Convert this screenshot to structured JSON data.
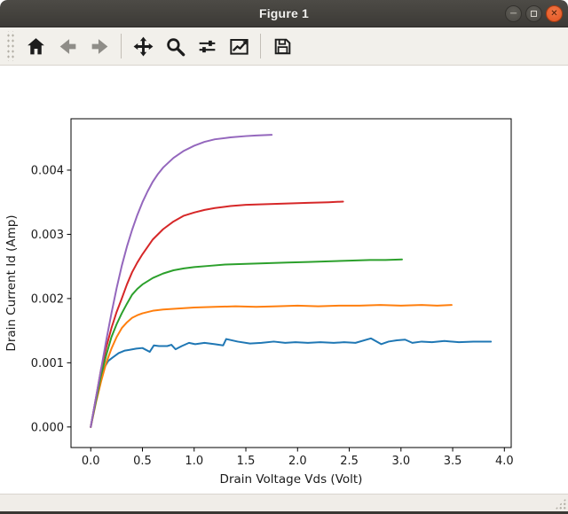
{
  "window": {
    "title": "Figure 1",
    "titlebar_color": "#403e3a",
    "controls": {
      "minimize": {
        "icon": "minimize-icon"
      },
      "maximize": {
        "icon": "maximize-icon"
      },
      "close": {
        "icon": "close-icon",
        "color": "#e35420"
      }
    }
  },
  "toolbar": {
    "buttons": [
      {
        "id": "home",
        "icon": "home-icon",
        "enabled": true
      },
      {
        "id": "back",
        "icon": "back-arrow-icon",
        "enabled": false
      },
      {
        "id": "forward",
        "icon": "forward-arrow-icon",
        "enabled": false
      },
      {
        "id": "pan",
        "icon": "pan-arrows-icon",
        "enabled": true
      },
      {
        "id": "zoom",
        "icon": "magnifier-icon",
        "enabled": true
      },
      {
        "id": "configure-subplots",
        "icon": "sliders-icon",
        "enabled": true
      },
      {
        "id": "edit-parameters",
        "icon": "line-graph-icon",
        "enabled": true
      },
      {
        "id": "save",
        "icon": "floppy-disk-icon",
        "enabled": true
      }
    ]
  },
  "statusbar": {
    "message": ""
  },
  "chart_data": {
    "type": "line",
    "title": "",
    "xlabel": "Drain Voltage Vds (Volt)",
    "ylabel": "Drain Current Id (Amp)",
    "xlim": [
      -0.191,
      4.066
    ],
    "ylim": [
      -0.00032,
      0.0048
    ],
    "grid": false,
    "legend": "none",
    "xticks": {
      "values": [
        0,
        0.5,
        1.0,
        1.5,
        2.0,
        2.5,
        3.0,
        3.5,
        4.0
      ],
      "labels": [
        "0.0",
        "0.5",
        "1.0",
        "1.5",
        "2.0",
        "2.5",
        "3.0",
        "3.5",
        "4.0"
      ]
    },
    "yticks": {
      "values": [
        0,
        0.001,
        0.002,
        0.003,
        0.004
      ],
      "labels": [
        "0.000",
        "0.001",
        "0.002",
        "0.003",
        "0.004"
      ]
    },
    "series": [
      {
        "name": "series-blue",
        "color": "#1f77b4",
        "x": [
          0,
          0.02,
          0.05,
          0.09,
          0.13,
          0.17,
          0.21,
          0.27,
          0.33,
          0.37,
          0.44,
          0.5,
          0.57,
          0.61,
          0.66,
          0.74,
          0.78,
          0.82,
          0.88,
          0.95,
          1.01,
          1.1,
          1.2,
          1.28,
          1.31,
          1.42,
          1.54,
          1.65,
          1.77,
          1.88,
          1.98,
          2.1,
          2.22,
          2.35,
          2.45,
          2.56,
          2.71,
          2.81,
          2.88,
          2.96,
          3.04,
          3.11,
          3.2,
          3.3,
          3.42,
          3.56,
          3.7,
          3.87
        ],
        "y": [
          0,
          0.00018,
          0.00044,
          0.00072,
          0.00092,
          0.00103,
          0.00108,
          0.00115,
          0.00119,
          0.0012,
          0.00122,
          0.00123,
          0.00117,
          0.00127,
          0.00126,
          0.00126,
          0.00128,
          0.00121,
          0.00126,
          0.00131,
          0.00129,
          0.00131,
          0.00129,
          0.00127,
          0.00137,
          0.00133,
          0.0013,
          0.00131,
          0.00133,
          0.00131,
          0.00132,
          0.00131,
          0.00132,
          0.00131,
          0.00132,
          0.00131,
          0.00138,
          0.00129,
          0.00133,
          0.00135,
          0.00136,
          0.00131,
          0.00133,
          0.00132,
          0.00134,
          0.00132,
          0.00133,
          0.00133
        ]
      },
      {
        "name": "series-orange",
        "color": "#ff7f0e",
        "x": [
          0,
          0.05,
          0.1,
          0.15,
          0.2,
          0.25,
          0.3,
          0.35,
          0.4,
          0.45,
          0.5,
          0.6,
          0.7,
          0.8,
          0.9,
          1.0,
          1.2,
          1.4,
          1.6,
          1.8,
          2.0,
          2.2,
          2.4,
          2.6,
          2.8,
          3.0,
          3.2,
          3.35,
          3.49
        ],
        "y": [
          0,
          0.00038,
          0.00071,
          0.001,
          0.00122,
          0.0014,
          0.00154,
          0.00163,
          0.0017,
          0.00174,
          0.00177,
          0.00181,
          0.00183,
          0.00184,
          0.00185,
          0.00186,
          0.00187,
          0.00188,
          0.00187,
          0.00188,
          0.00189,
          0.00188,
          0.00189,
          0.00189,
          0.0019,
          0.00189,
          0.0019,
          0.00189,
          0.0019
        ]
      },
      {
        "name": "series-green",
        "color": "#2ca02c",
        "x": [
          0,
          0.05,
          0.1,
          0.15,
          0.2,
          0.25,
          0.3,
          0.35,
          0.4,
          0.45,
          0.5,
          0.6,
          0.7,
          0.8,
          0.9,
          1.0,
          1.15,
          1.3,
          1.5,
          1.7,
          1.9,
          2.1,
          2.3,
          2.5,
          2.7,
          2.85,
          3.01
        ],
        "y": [
          0,
          0.0004,
          0.00081,
          0.00112,
          0.0014,
          0.0016,
          0.00177,
          0.00192,
          0.00206,
          0.00215,
          0.00222,
          0.00232,
          0.00239,
          0.00244,
          0.00247,
          0.00249,
          0.00251,
          0.00253,
          0.00254,
          0.00255,
          0.00256,
          0.00257,
          0.00258,
          0.00259,
          0.0026,
          0.0026,
          0.00261
        ]
      },
      {
        "name": "series-red",
        "color": "#d62728",
        "x": [
          0,
          0.05,
          0.1,
          0.15,
          0.2,
          0.25,
          0.3,
          0.35,
          0.4,
          0.45,
          0.5,
          0.6,
          0.7,
          0.8,
          0.9,
          1.0,
          1.1,
          1.2,
          1.35,
          1.5,
          1.7,
          1.9,
          2.1,
          2.3,
          2.44
        ],
        "y": [
          0,
          0.00045,
          0.0009,
          0.00124,
          0.00154,
          0.00179,
          0.002,
          0.00222,
          0.00241,
          0.00256,
          0.00269,
          0.00292,
          0.00308,
          0.0032,
          0.00329,
          0.00334,
          0.00338,
          0.00341,
          0.00344,
          0.00346,
          0.00347,
          0.00348,
          0.00349,
          0.0035,
          0.00351
        ]
      },
      {
        "name": "series-purple",
        "color": "#9467bd",
        "x": [
          0,
          0.05,
          0.1,
          0.15,
          0.2,
          0.25,
          0.3,
          0.35,
          0.4,
          0.45,
          0.5,
          0.55,
          0.6,
          0.65,
          0.7,
          0.8,
          0.9,
          1.0,
          1.1,
          1.2,
          1.35,
          1.5,
          1.6,
          1.75
        ],
        "y": [
          0,
          0.00045,
          0.0009,
          0.00135,
          0.00177,
          0.00216,
          0.00251,
          0.00281,
          0.00307,
          0.0033,
          0.0035,
          0.00367,
          0.00382,
          0.00394,
          0.00404,
          0.00419,
          0.0043,
          0.00438,
          0.00444,
          0.00448,
          0.00451,
          0.00453,
          0.00454,
          0.00455
        ]
      }
    ]
  }
}
